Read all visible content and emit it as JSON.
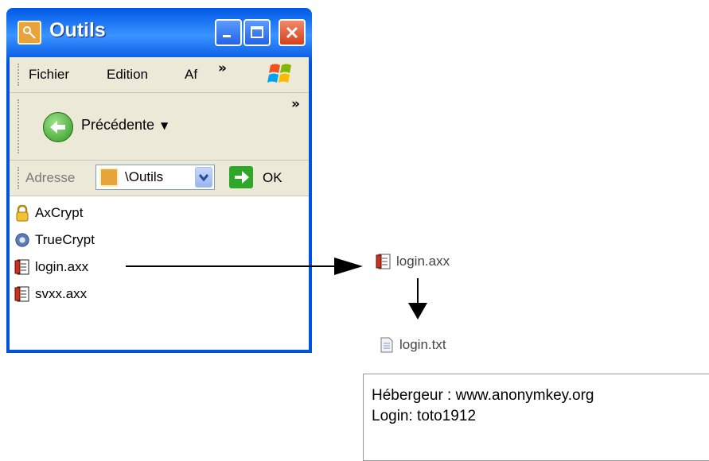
{
  "window": {
    "title": "Outils",
    "menu": [
      "Fichier",
      "Edition",
      "Af"
    ],
    "menu_chevron": "»",
    "toolbar_chevron": "»",
    "back_label": "Précédente",
    "back_dropdown": "▼",
    "address_label": "Adresse",
    "address_value": "\\Outils",
    "go_label": "OK",
    "files": [
      {
        "name": "AxCrypt",
        "icon": "lock-icon"
      },
      {
        "name": "TrueCrypt",
        "icon": "gear-icon"
      },
      {
        "name": "login.axx",
        "icon": "encrypted-file-icon"
      },
      {
        "name": "svxx.axx",
        "icon": "encrypted-file-icon"
      }
    ]
  },
  "diagram": {
    "encrypted_file": "login.axx",
    "decrypted_file": "login.txt"
  },
  "note": {
    "line1": "Hébergeur : www.anonymkey.org",
    "line2": "Login: toto1912"
  }
}
